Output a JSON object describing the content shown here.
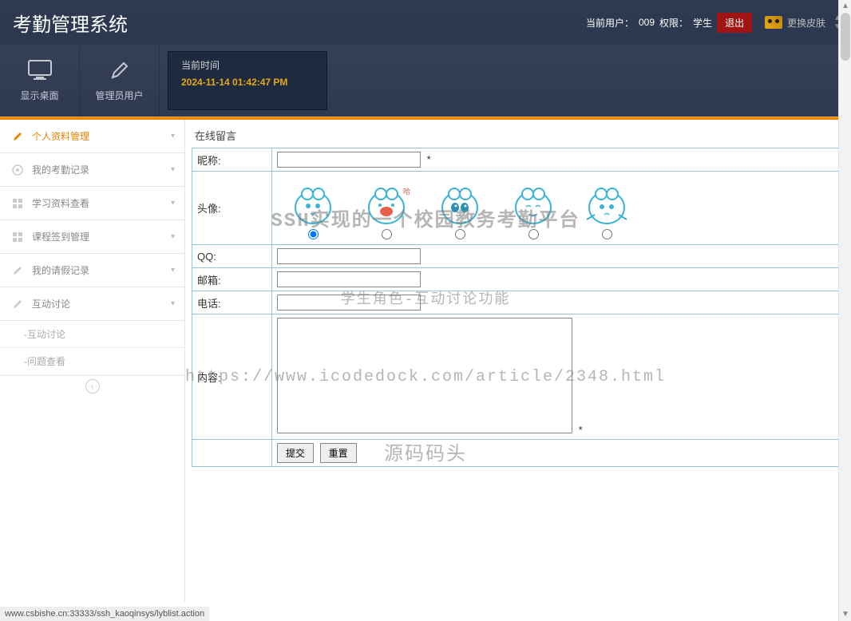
{
  "header": {
    "app_title": "考勤管理系统",
    "user_prefix": "当前用户：",
    "user_id": "009",
    "role_prefix": "权限：",
    "role": "学生",
    "logout": "退出",
    "skin": "更换皮肤"
  },
  "toolbar": {
    "desktop": "显示桌面",
    "admin": "管理员用户"
  },
  "time_panel": {
    "label": "当前时间",
    "value": "2024-11-14 01:42:47 PM"
  },
  "sidebar": {
    "items": [
      {
        "label": "个人资料管理",
        "icon": "pencil",
        "active": true
      },
      {
        "label": "我的考勤记录",
        "icon": "target"
      },
      {
        "label": "学习资料查看",
        "icon": "grid"
      },
      {
        "label": "课程签到管理",
        "icon": "grid"
      },
      {
        "label": "我的请假记录",
        "icon": "pencil"
      },
      {
        "label": "互动讨论",
        "icon": "pencil"
      }
    ],
    "subs": [
      {
        "label": "-互动讨论"
      },
      {
        "label": "-问题查看"
      }
    ]
  },
  "form": {
    "panel_title": "在线留言",
    "nickname_label": "昵称:",
    "avatar_label": "头像:",
    "qq_label": "QQ:",
    "email_label": "邮箱:",
    "phone_label": "电话:",
    "content_label": "内容:",
    "required": "*",
    "submit": "提交",
    "reset": "重置"
  },
  "watermarks": {
    "w1": "SSH实现的一个校园教务考勤平台",
    "w2": "学生角色-互动讨论功能",
    "w3": "https://www.icodedock.com/article/2348.html",
    "w4": "源码码头"
  },
  "status_bar": "www.csbishe.cn:33333/ssh_kaoqinsys/lyblist.action"
}
